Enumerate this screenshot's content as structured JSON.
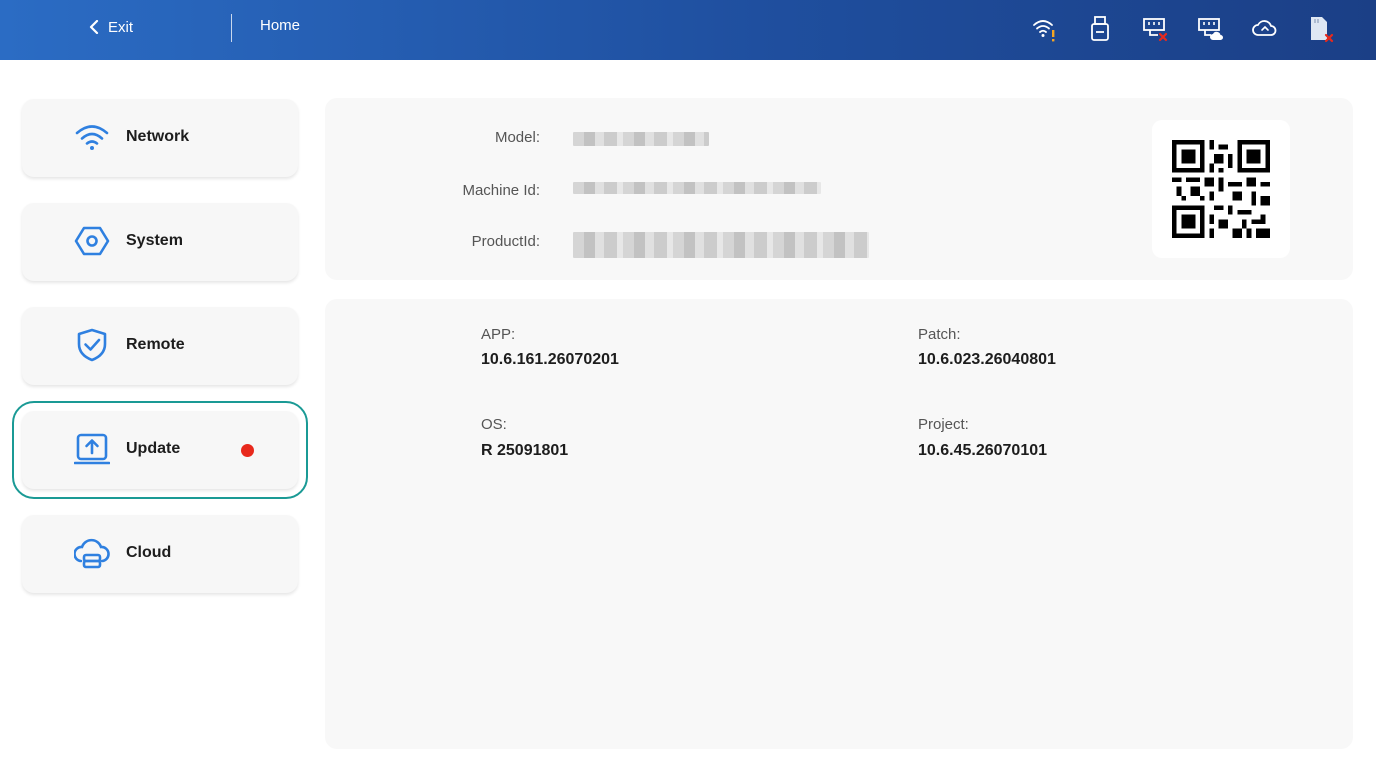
{
  "header": {
    "exit_label": "Exit",
    "home_label": "Home",
    "status_icons": [
      "wifi-warning-icon",
      "usb-drive-icon",
      "network-disconnected-icon",
      "network-cloud-icon",
      "cloud-icon",
      "sd-card-error-icon"
    ]
  },
  "sidebar": {
    "items": [
      {
        "label": "Network",
        "icon": "wifi-icon"
      },
      {
        "label": "System",
        "icon": "system-icon"
      },
      {
        "label": "Remote",
        "icon": "shield-check-icon"
      },
      {
        "label": "Update",
        "icon": "upload-icon",
        "active": true,
        "badge": "red-dot"
      },
      {
        "label": "Cloud",
        "icon": "cloud-server-icon"
      }
    ]
  },
  "device_info": {
    "model_label": "Model:",
    "machine_id_label": "Machine Id:",
    "product_id_label": "ProductId:"
  },
  "versions": {
    "app": {
      "title": "APP:",
      "value": "10.6.161.26070201"
    },
    "patch": {
      "title": "Patch:",
      "value": "10.6.023.26040801"
    },
    "os": {
      "title": "OS:",
      "value": "R 25091801"
    },
    "project": {
      "title": "Project:",
      "value": "10.6.45.26070101"
    }
  },
  "colors": {
    "accent": "#2f80e0",
    "active_outline": "#1a9a95",
    "badge": "#e8291c",
    "header_start": "#2b6cc4",
    "header_end": "#1b3f86"
  }
}
